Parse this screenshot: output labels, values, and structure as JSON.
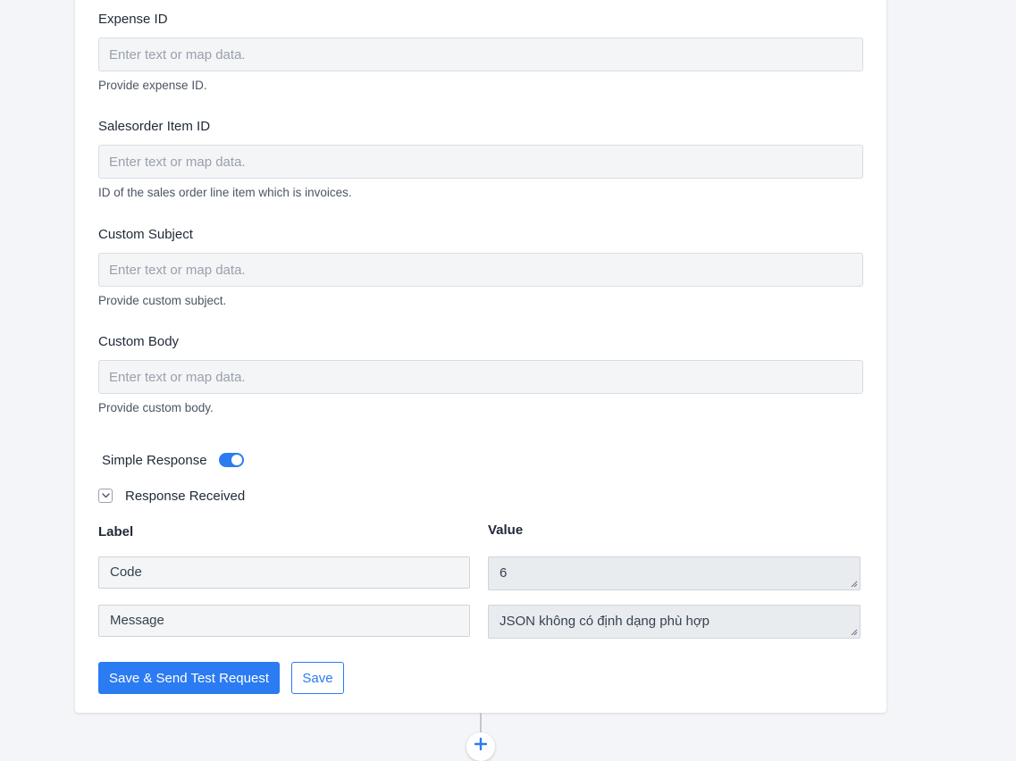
{
  "form": {
    "fields": [
      {
        "label": "Expense ID",
        "placeholder": "Enter text or map data.",
        "value": "",
        "help": "Provide expense ID."
      },
      {
        "label": "Salesorder Item ID",
        "placeholder": "Enter text or map data.",
        "value": "",
        "help": "ID of the sales order line item which is invoices."
      },
      {
        "label": "Custom Subject",
        "placeholder": "Enter text or map data.",
        "value": "",
        "help": "Provide custom subject."
      },
      {
        "label": "Custom Body",
        "placeholder": "Enter text or map data.",
        "value": "",
        "help": "Provide custom body."
      }
    ],
    "simple_response": {
      "label": "Simple Response",
      "enabled": true
    },
    "response": {
      "label": "Response Received",
      "expanded": true,
      "columns": {
        "label": "Label",
        "value": "Value"
      },
      "rows": [
        {
          "label": "Code",
          "value": "6"
        },
        {
          "label": "Message",
          "value": "JSON không có định dạng phù hợp"
        }
      ]
    },
    "buttons": {
      "save_and_test": "Save & Send Test Request",
      "save": "Save"
    }
  },
  "colors": {
    "accent": "#2b7bf3",
    "page_bg": "#f3f5f8",
    "input_bg": "#f3f5f7"
  },
  "icons": {
    "toggle": "toggle-switch",
    "collapse": "chevron-down-icon",
    "add_step": "plus-icon"
  }
}
